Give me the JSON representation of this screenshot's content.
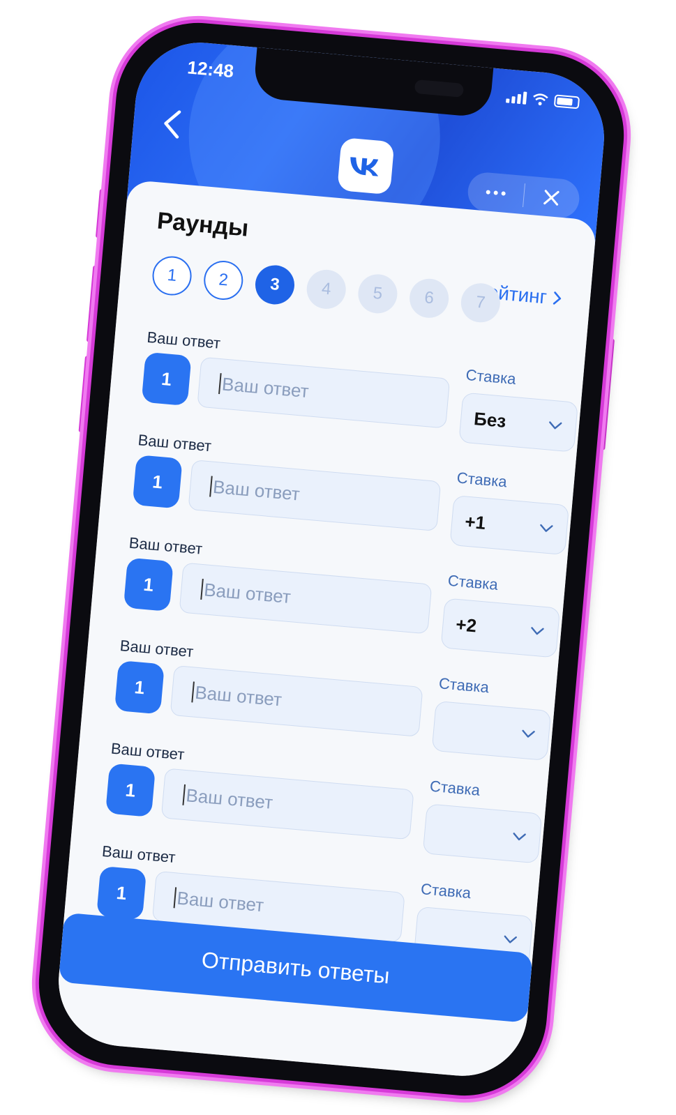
{
  "status_bar": {
    "time": "12:48"
  },
  "header": {
    "back_icon": "chevron-left-icon",
    "logo_icon": "vk-logo-icon",
    "more_icon": "more-dots-icon",
    "close_icon": "close-icon"
  },
  "sheet": {
    "title": "Раунды",
    "rating_label": "Рейтинг",
    "rounds": [
      {
        "label": "1",
        "state": "done"
      },
      {
        "label": "2",
        "state": "done"
      },
      {
        "label": "3",
        "state": "active"
      },
      {
        "label": "4",
        "state": "future"
      },
      {
        "label": "5",
        "state": "future"
      },
      {
        "label": "6",
        "state": "future"
      },
      {
        "label": "7",
        "state": "future"
      }
    ],
    "answers": [
      {
        "label": "Ваш ответ",
        "number": "1",
        "placeholder": "Ваш ответ",
        "stake_label": "Ставка",
        "stake_value": "Без"
      },
      {
        "label": "Ваш ответ",
        "number": "1",
        "placeholder": "Ваш ответ",
        "stake_label": "Ставка",
        "stake_value": "+1"
      },
      {
        "label": "Ваш ответ",
        "number": "1",
        "placeholder": "Ваш ответ",
        "stake_label": "Ставка",
        "stake_value": "+2"
      },
      {
        "label": "Ваш ответ",
        "number": "1",
        "placeholder": "Ваш ответ",
        "stake_label": "Ставка",
        "stake_value": ""
      },
      {
        "label": "Ваш ответ",
        "number": "1",
        "placeholder": "Ваш ответ",
        "stake_label": "Ставка",
        "stake_value": ""
      },
      {
        "label": "Ваш ответ",
        "number": "1",
        "placeholder": "Ваш ответ",
        "stake_label": "Ставка",
        "stake_value": ""
      }
    ],
    "submit_label": "Отправить ответы"
  },
  "colors": {
    "accent": "#2a74f2",
    "frame_outline": "#d63ad8",
    "header": "#2c6cf4"
  }
}
